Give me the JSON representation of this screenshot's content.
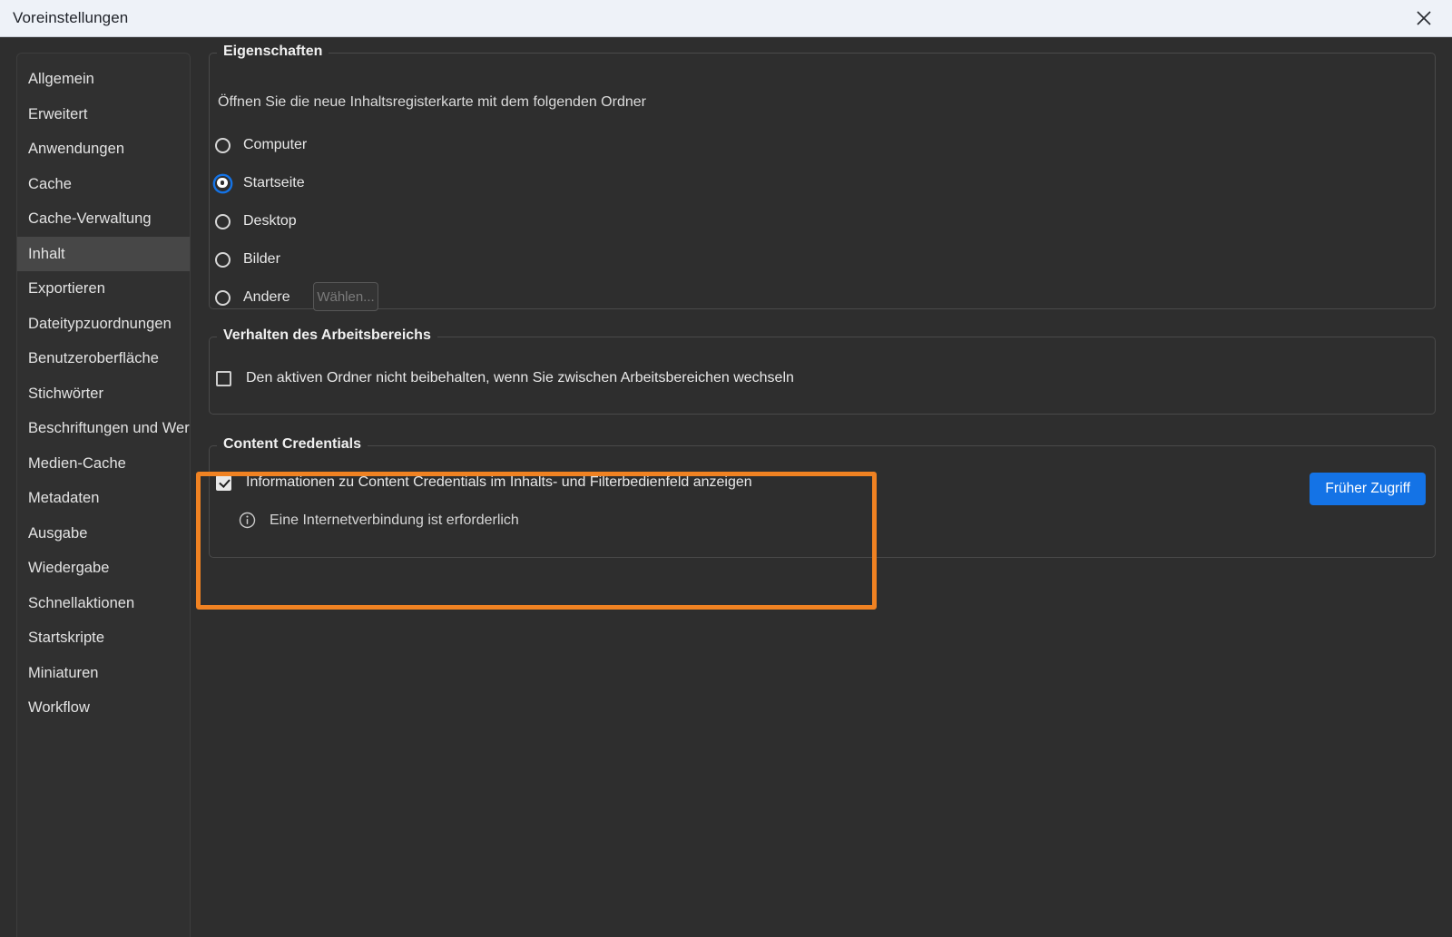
{
  "window": {
    "title": "Voreinstellungen",
    "close_icon": "close-icon"
  },
  "sidebar": {
    "items": [
      {
        "label": "Allgemein",
        "selected": false
      },
      {
        "label": "Erweitert",
        "selected": false
      },
      {
        "label": "Anwendungen",
        "selected": false
      },
      {
        "label": "Cache",
        "selected": false
      },
      {
        "label": "Cache-Verwaltung",
        "selected": false
      },
      {
        "label": "Inhalt",
        "selected": true
      },
      {
        "label": "Exportieren",
        "selected": false
      },
      {
        "label": "Dateitypzuordnungen",
        "selected": false
      },
      {
        "label": "Benutzeroberfläche",
        "selected": false
      },
      {
        "label": "Stichwörter",
        "selected": false
      },
      {
        "label": "Beschriftungen und Wertungen",
        "selected": false
      },
      {
        "label": "Medien-Cache",
        "selected": false
      },
      {
        "label": "Metadaten",
        "selected": false
      },
      {
        "label": "Ausgabe",
        "selected": false
      },
      {
        "label": "Wiedergabe",
        "selected": false
      },
      {
        "label": "Schnellaktionen",
        "selected": false
      },
      {
        "label": "Startskripte",
        "selected": false
      },
      {
        "label": "Miniaturen",
        "selected": false
      },
      {
        "label": "Workflow",
        "selected": false
      }
    ]
  },
  "properties_group": {
    "title": "Eigenschaften",
    "description": "Öffnen Sie die neue Inhaltsregisterkarte mit dem folgenden Ordner",
    "options": [
      {
        "label": "Computer",
        "selected": false
      },
      {
        "label": "Startseite",
        "selected": true
      },
      {
        "label": "Desktop",
        "selected": false
      },
      {
        "label": "Bilder",
        "selected": false
      },
      {
        "label": "Andere",
        "selected": false
      }
    ],
    "choose_button": {
      "label": "Wählen...",
      "disabled": true
    }
  },
  "workspace_group": {
    "title": "Verhalten des Arbeitsbereichs",
    "checkbox": {
      "label": "Den aktiven Ordner nicht beibehalten, wenn Sie zwischen Arbeitsbereichen wechseln",
      "checked": false
    }
  },
  "content_credentials_group": {
    "title": "Content Credentials",
    "checkbox": {
      "label": "Informationen zu Content Credentials im Inhalts- und Filterbedienfeld anzeigen",
      "checked": true
    },
    "info": {
      "icon": "info-circle-icon",
      "text": "Eine Internetverbindung ist erforderlich"
    },
    "early_access_button": "Früher Zugriff",
    "highlighted": true
  },
  "colors": {
    "accent_blue": "#1473e6",
    "highlight_orange": "#f08222",
    "dialog_background": "#2e2e2e",
    "titlebar_background": "#eef2f8",
    "sidebar_selected": "#474747"
  }
}
